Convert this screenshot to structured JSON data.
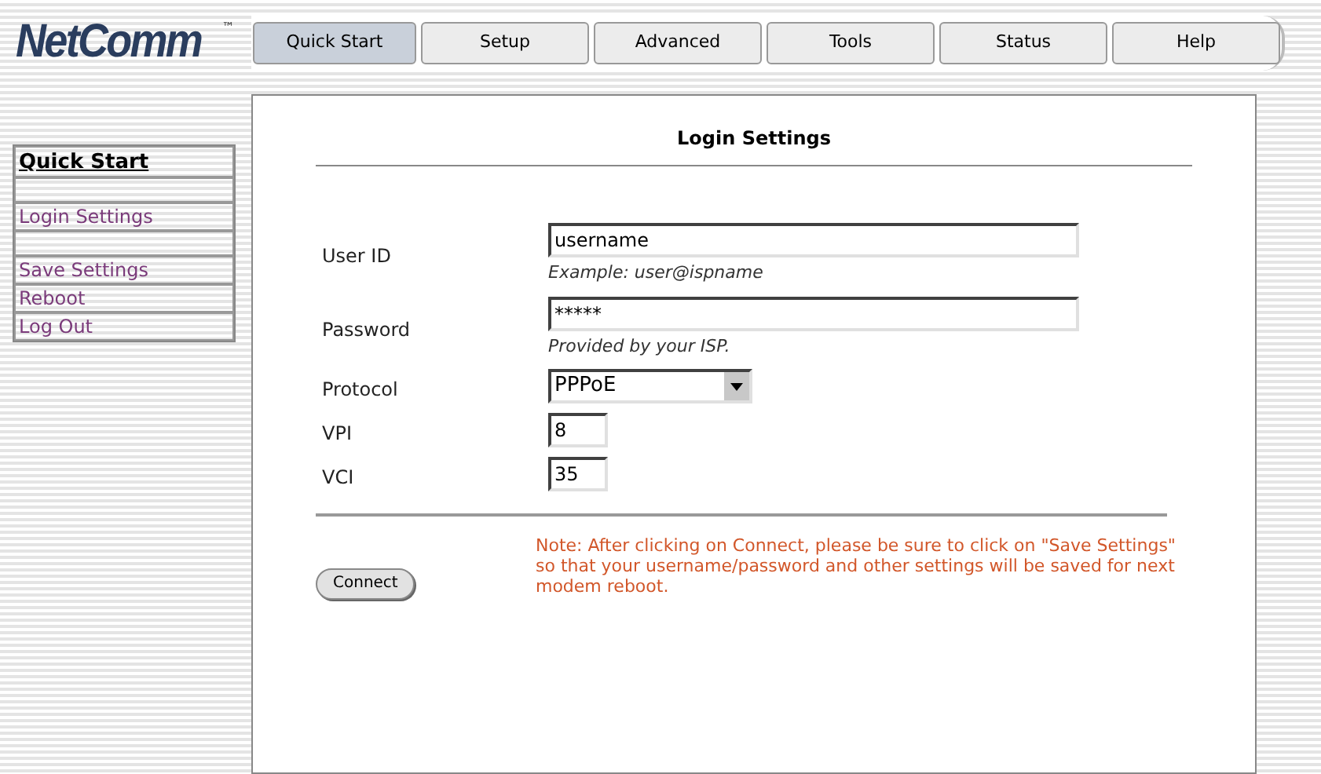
{
  "logo": {
    "text": "NetComm",
    "mark": "™"
  },
  "tabs": [
    {
      "label": "Quick Start",
      "selected": true
    },
    {
      "label": "Setup",
      "selected": false
    },
    {
      "label": "Advanced",
      "selected": false
    },
    {
      "label": "Tools",
      "selected": false
    },
    {
      "label": "Status",
      "selected": false
    },
    {
      "label": "Help",
      "selected": false
    }
  ],
  "sidebar": {
    "items": [
      {
        "kind": "heading",
        "label": "Quick Start"
      },
      {
        "kind": "spacer"
      },
      {
        "kind": "link",
        "label": "Login Settings"
      },
      {
        "kind": "spacer"
      },
      {
        "kind": "link",
        "label": "Save Settings"
      },
      {
        "kind": "link",
        "label": "Reboot"
      },
      {
        "kind": "link",
        "label": "Log Out"
      }
    ]
  },
  "panel": {
    "title": "Login Settings",
    "fields": [
      {
        "kind": "text",
        "label": "User ID",
        "value": "username",
        "hint": "Example: user@ispname"
      },
      {
        "kind": "password",
        "label": "Password",
        "value": "*****",
        "hint": "Provided by your ISP."
      },
      {
        "kind": "select",
        "label": "Protocol",
        "value": "PPPoE"
      },
      {
        "kind": "short",
        "label": "VPI",
        "value": "8"
      },
      {
        "kind": "short",
        "label": "VCI",
        "value": "35"
      }
    ],
    "button": "Connect",
    "note": "Note: After clicking on Connect, please be sure to click on \"Save Settings\" so that your username/password and other settings will be saved for next modem reboot."
  }
}
